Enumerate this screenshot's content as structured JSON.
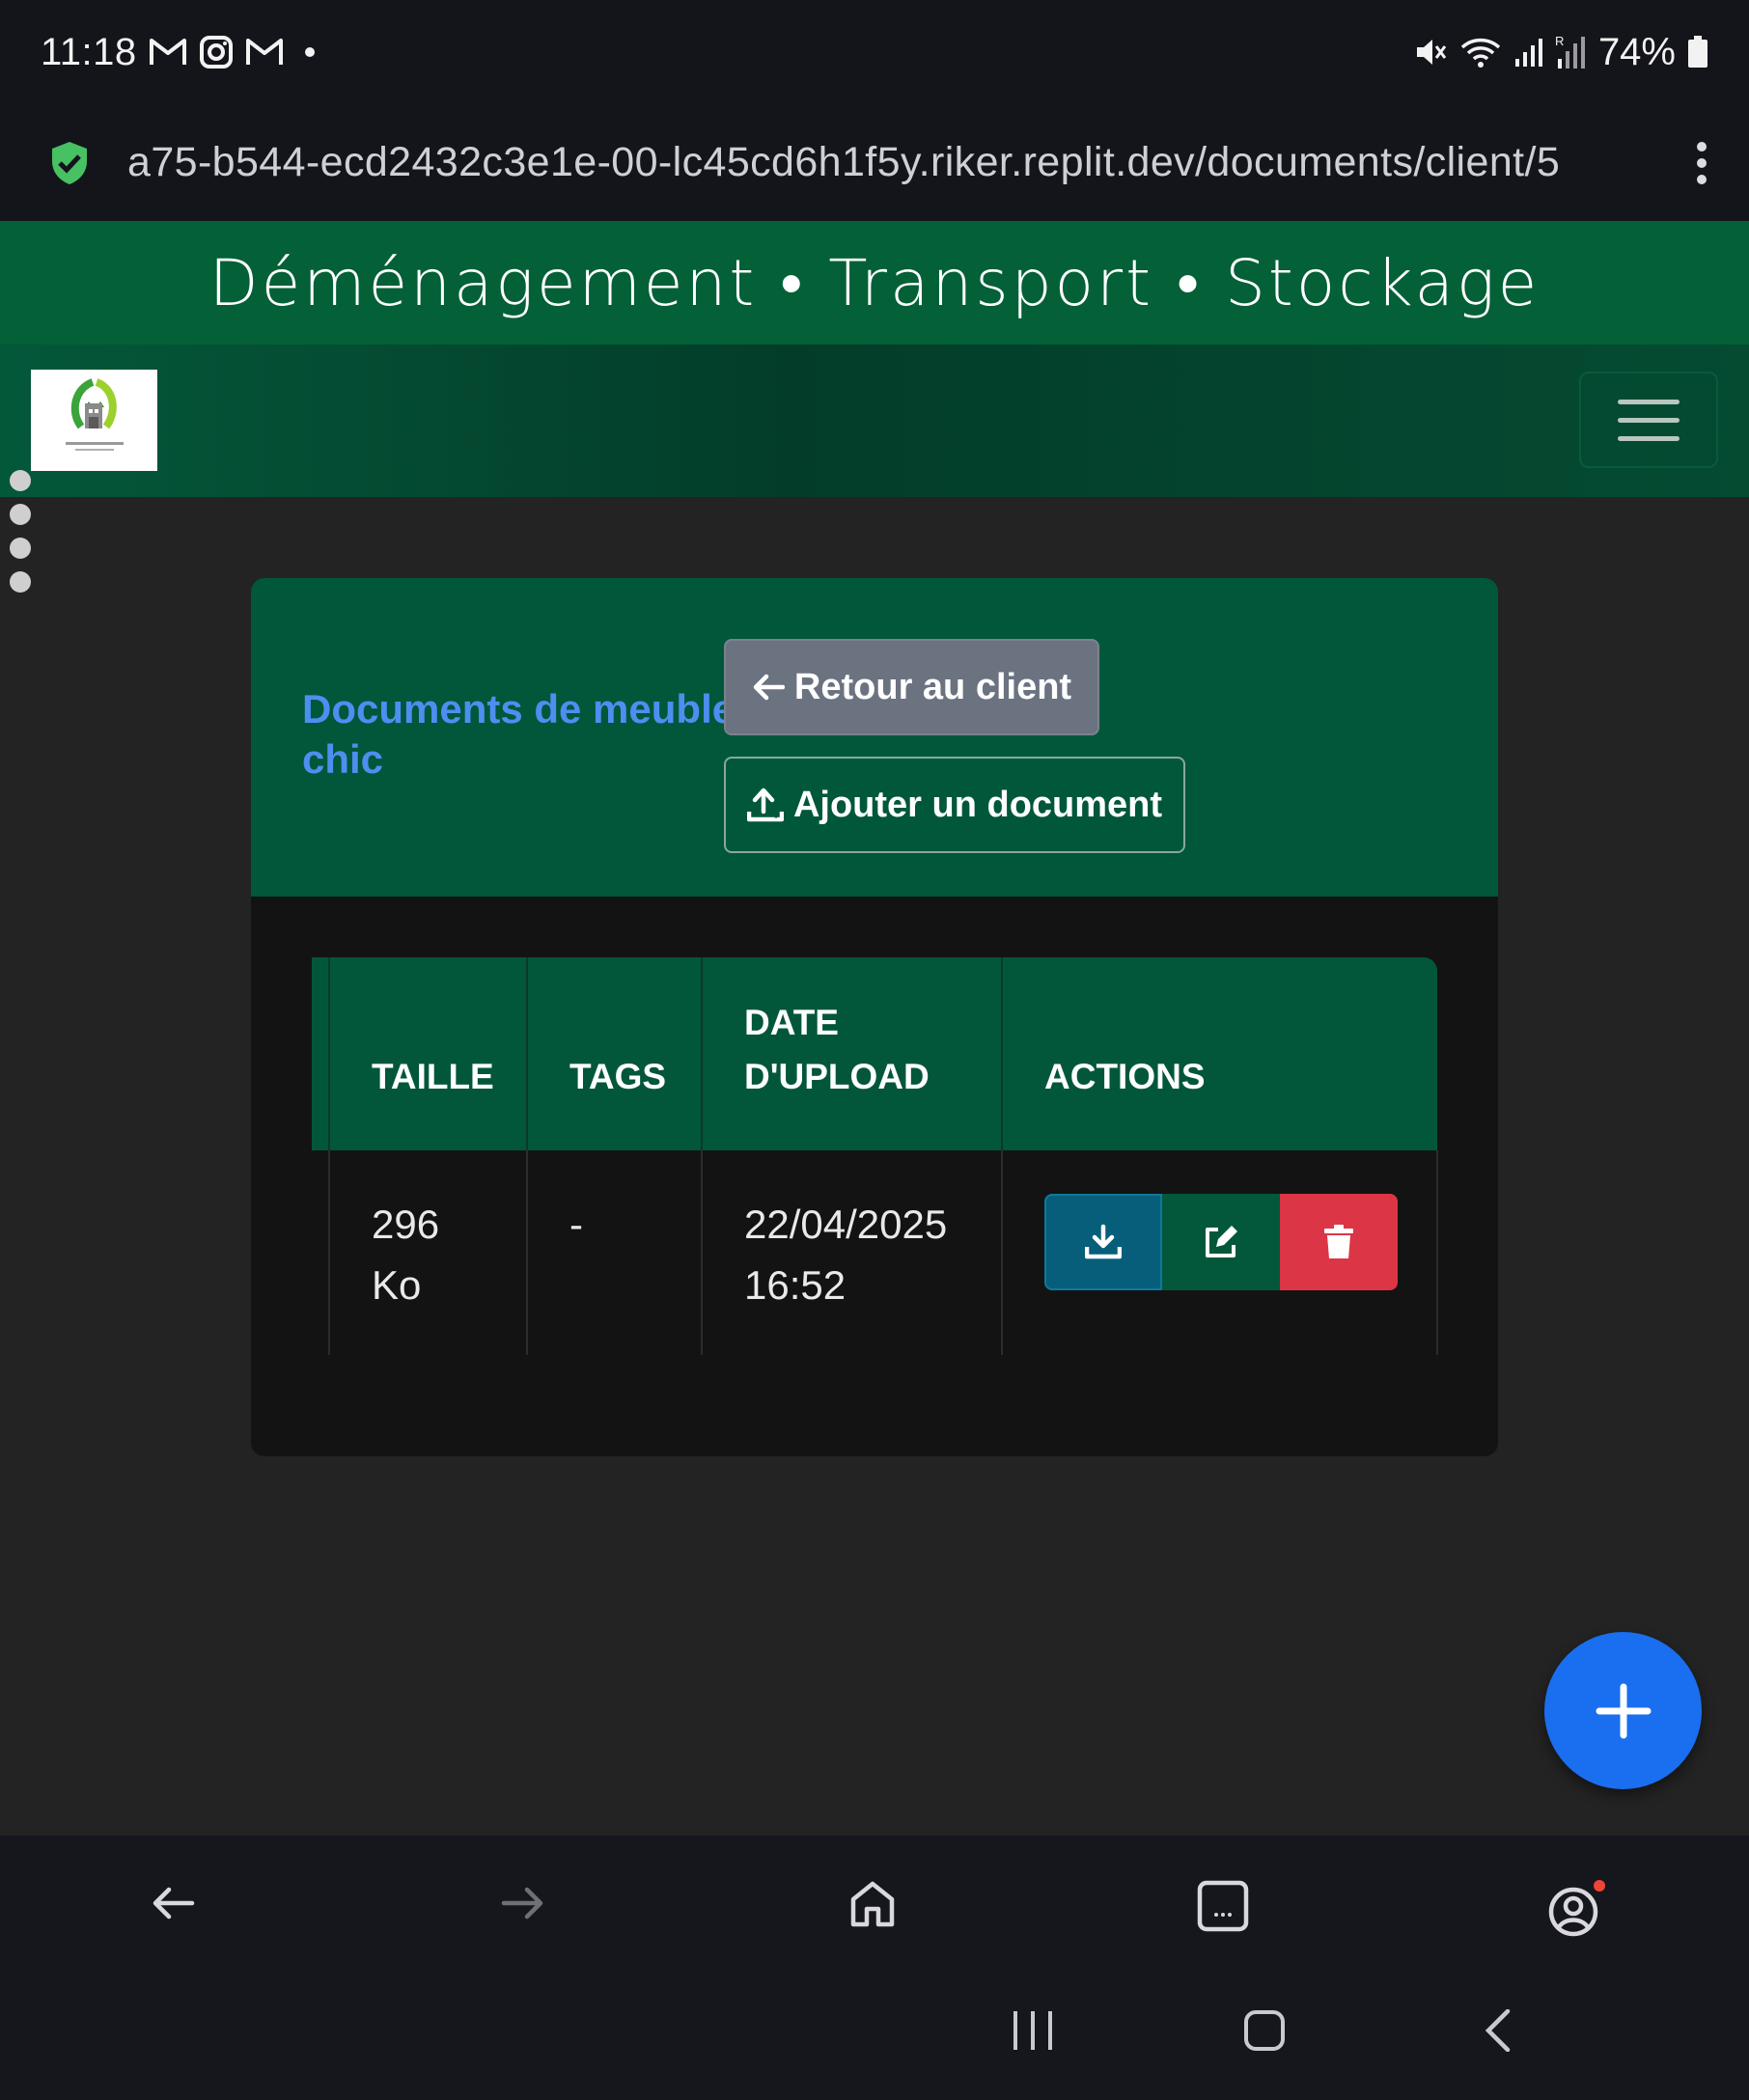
{
  "status_bar": {
    "time": "11:18",
    "battery": "74%",
    "notification_icons": [
      "gmail-icon",
      "instagram-icon",
      "gmail-icon",
      "dot-icon"
    ],
    "system_icons": [
      "mute-icon",
      "wifi-icon",
      "signal-icon",
      "signal-roaming-icon",
      "battery-icon"
    ]
  },
  "browser": {
    "url": "a75-b544-ecd2432c3e1e-00-lc45cd6h1f5y.riker.replit.dev/documents/client/5",
    "secure_icon": "shield-check-icon",
    "menu_icon": "more-vert-icon"
  },
  "site": {
    "tagline": "Déménagement • Transport • Stockage",
    "logo": "company-logo",
    "menu_icon": "hamburger-icon"
  },
  "card": {
    "title": "Documents de meuble chic",
    "back_button": "Retour au client",
    "add_button": "Ajouter un document"
  },
  "table": {
    "headers": [
      "",
      "TAILLE",
      "TAGS",
      "DATE D'UPLOAD",
      "ACTIONS"
    ],
    "rows": [
      {
        "name": "",
        "size": "296 Ko",
        "tags": "-",
        "date": "22/04/2025 16:52"
      }
    ],
    "action_icons": [
      "download-icon",
      "edit-icon",
      "trash-icon"
    ]
  },
  "fab_icon": "plus-icon",
  "bottom_nav_icons": [
    "back-arrow-icon",
    "forward-arrow-icon",
    "home-icon",
    "tabs-icon",
    "profile-icon"
  ],
  "system_nav_icons": [
    "recents-icon",
    "home-button-icon",
    "back-icon"
  ],
  "colors": {
    "brand_green": "#01573a",
    "title_blue": "#4c8ff0",
    "download_blue": "#075e7a",
    "delete_red": "#dc3545",
    "fab_blue": "#1a6ef0"
  }
}
